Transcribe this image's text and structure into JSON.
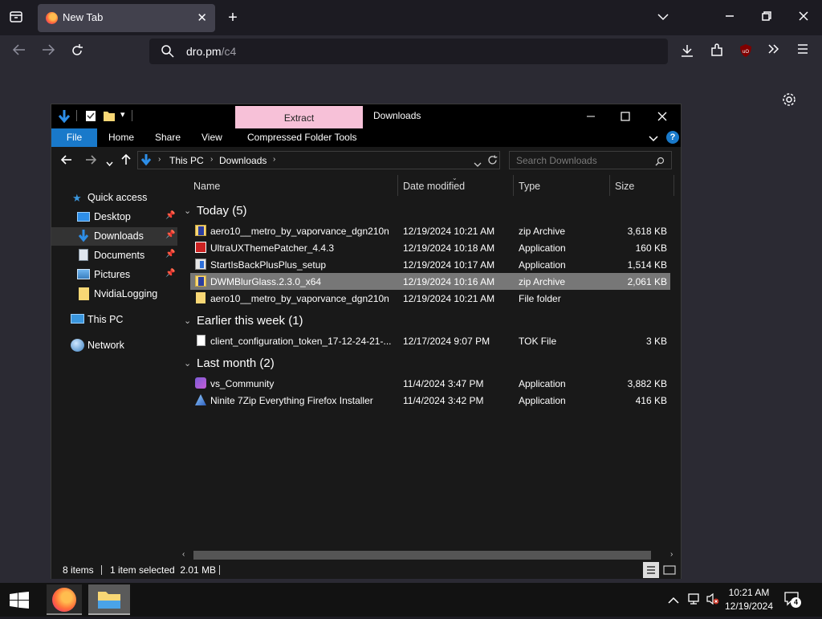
{
  "browser": {
    "tab_title": "New Tab",
    "url_host": "dro.pm",
    "url_path": "/c4"
  },
  "explorer": {
    "ribbon_context_label": "Extract",
    "window_title": "Downloads",
    "ribbon_tabs": [
      "File",
      "Home",
      "Share",
      "View",
      "Compressed Folder Tools"
    ],
    "breadcrumb": [
      "This PC",
      "Downloads"
    ],
    "search_placeholder": "Search Downloads",
    "nav": {
      "quick_access": "Quick access",
      "desktop": "Desktop",
      "downloads": "Downloads",
      "documents": "Documents",
      "pictures": "Pictures",
      "nvidia_logging": "NvidiaLogging",
      "this_pc": "This PC",
      "network": "Network"
    },
    "columns": [
      "Name",
      "Date modified",
      "Type",
      "Size"
    ],
    "groups": {
      "today": "Today (5)",
      "earlier": "Earlier this week (1)",
      "last_month": "Last month (2)"
    },
    "rows": [
      {
        "name": "aero10__metro_by_vaporvance_dgn210n",
        "date": "12/19/2024 10:21 AM",
        "type": "zip Archive",
        "size": "3,618 KB"
      },
      {
        "name": "UltraUXThemePatcher_4.4.3",
        "date": "12/19/2024 10:18 AM",
        "type": "Application",
        "size": "160 KB"
      },
      {
        "name": "StartIsBackPlusPlus_setup",
        "date": "12/19/2024 10:17 AM",
        "type": "Application",
        "size": "1,514 KB"
      },
      {
        "name": "DWMBlurGlass.2.3.0_x64",
        "date": "12/19/2024 10:16 AM",
        "type": "zip Archive",
        "size": "2,061 KB"
      },
      {
        "name": "aero10__metro_by_vaporvance_dgn210n",
        "date": "12/19/2024 10:21 AM",
        "type": "File folder",
        "size": ""
      },
      {
        "name": "client_configuration_token_17-12-24-21-...",
        "date": "12/17/2024 9:07 PM",
        "type": "TOK File",
        "size": "3 KB"
      },
      {
        "name": "vs_Community",
        "date": "11/4/2024 3:47 PM",
        "type": "Application",
        "size": "3,882 KB"
      },
      {
        "name": "Ninite 7Zip Everything Firefox Installer",
        "date": "11/4/2024 3:42 PM",
        "type": "Application",
        "size": "416 KB"
      }
    ],
    "status": {
      "items": "8 items",
      "selected": "1 item selected  2.01 MB"
    }
  },
  "taskbar": {
    "time": "10:21 AM",
    "date": "12/19/2024",
    "notification_count": "4"
  },
  "colors": {
    "accent": "#1979ca",
    "extract_tab": "#f7c1d8",
    "selection": "#777777"
  }
}
